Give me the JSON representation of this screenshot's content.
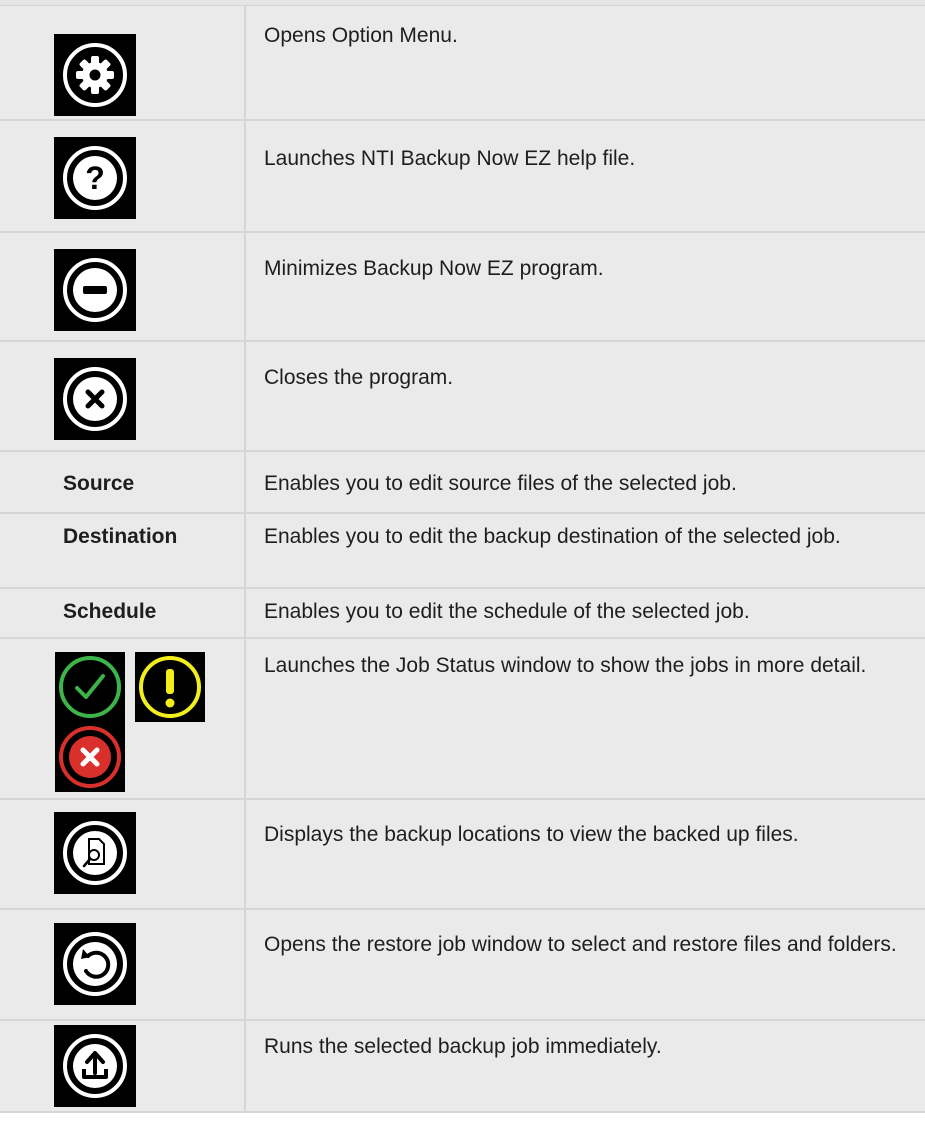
{
  "rows": [
    {
      "icon": "gear-icon",
      "description": "Opens Option Menu."
    },
    {
      "icon": "help-question-icon",
      "description": "Launches NTI Backup Now EZ help file."
    },
    {
      "icon": "minimize-icon",
      "description": "Minimizes Backup Now EZ program."
    },
    {
      "icon": "close-icon",
      "description": "Closes the program."
    },
    {
      "term": "Source",
      "description": "Enables you to edit source files of the selected job."
    },
    {
      "term": "Destination",
      "description": "Enables you to edit the backup destination of the selected job."
    },
    {
      "term": "Schedule",
      "description": "Enables you to edit the schedule of the selected job."
    },
    {
      "icons": [
        "status-ok-icon",
        "status-warning-icon",
        "status-error-icon"
      ],
      "description": "Launches the Job Status window to show the jobs in more detail."
    },
    {
      "icon": "view-backup-files-icon",
      "description": "Displays the backup locations to view the backed up files."
    },
    {
      "icon": "restore-icon",
      "description": "Opens the restore job window to select and restore files and folders."
    },
    {
      "icon": "run-backup-icon",
      "description": "Runs the selected backup job immediately."
    }
  ],
  "colors": {
    "ok_green": "#3cb44a",
    "warning_yellow": "#f2ee1c",
    "error_red": "#d9302c",
    "table_bg": "#eaeaea",
    "border": "#d6d6d6"
  }
}
